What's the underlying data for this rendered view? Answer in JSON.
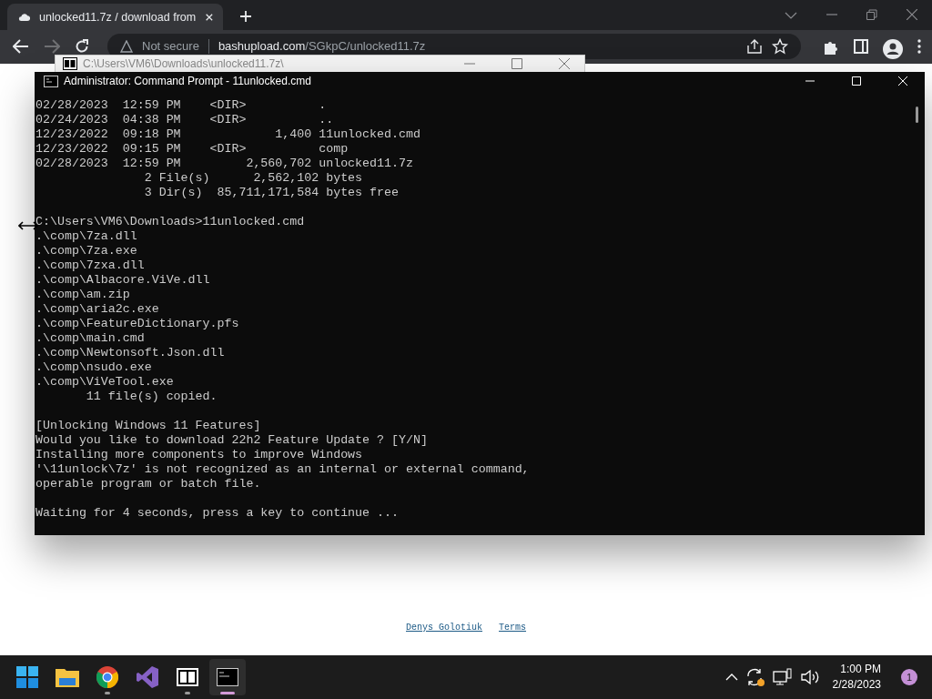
{
  "browser": {
    "tab": {
      "title": "unlocked11.7z / download from",
      "selected": true
    },
    "address": {
      "security": "Not secure",
      "host": "bashupload.com",
      "path": "/SGkpC/unlocked11.7z"
    }
  },
  "archive_window": {
    "title": "C:\\Users\\VM6\\Downloads\\unlocked11.7z\\"
  },
  "console_window": {
    "title": "Administrator:  Command Prompt - 11unlocked.cmd",
    "blocks": [
      [
        "02/28/2023  12:59 PM    <DIR>          .",
        "02/24/2023  04:38 PM    <DIR>          ..",
        "12/23/2022  09:18 PM             1,400 11unlocked.cmd",
        "12/23/2022  09:15 PM    <DIR>          comp",
        "02/28/2023  12:59 PM         2,560,702 unlocked11.7z",
        "               2 File(s)      2,562,102 bytes",
        "               3 Dir(s)  85,711,171,584 bytes free"
      ],
      [
        "C:\\Users\\VM6\\Downloads>11unlocked.cmd",
        ".\\comp\\7za.dll",
        ".\\comp\\7za.exe",
        ".\\comp\\7zxa.dll",
        ".\\comp\\Albacore.ViVe.dll",
        ".\\comp\\am.zip",
        ".\\comp\\aria2c.exe",
        ".\\comp\\FeatureDictionary.pfs",
        ".\\comp\\main.cmd",
        ".\\comp\\Newtonsoft.Json.dll",
        ".\\comp\\nsudo.exe",
        ".\\comp\\ViVeTool.exe",
        "       11 file(s) copied."
      ],
      [
        "[Unlocking Windows 11 Features]",
        "Would you like to download 22h2 Feature Update ? [Y/N]",
        "Installing more components to improve Windows",
        "'\\11unlock\\7z' is not recognized as an internal or external command,",
        "operable program or batch file."
      ],
      [
        "Waiting for 4 seconds, press a key to continue ..."
      ]
    ]
  },
  "footer_links": [
    "Denys Golotiuk",
    "Terms"
  ],
  "taskbar": {
    "apps": [
      {
        "kind": "start",
        "running": false,
        "selected": false
      },
      {
        "kind": "folder",
        "running": false,
        "selected": false
      },
      {
        "kind": "browser",
        "running": true,
        "selected": false
      },
      {
        "kind": "ide",
        "running": false,
        "selected": false
      },
      {
        "kind": "archive",
        "running": true,
        "selected": false
      },
      {
        "kind": "terminal",
        "running": true,
        "selected": true
      }
    ],
    "time": "1:00 PM",
    "date": "2/28/2023",
    "notifications": "1"
  }
}
